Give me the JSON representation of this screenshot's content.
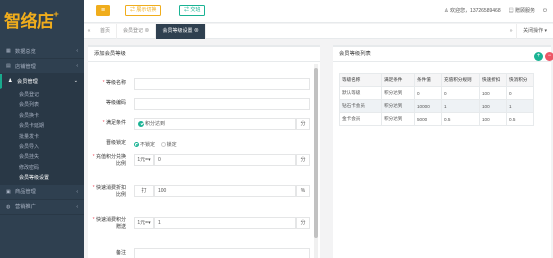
{
  "brand": {
    "logo_text": "智络店",
    "logo_plus": "+"
  },
  "sidebar": {
    "items": [
      {
        "label": "数据总览",
        "icon": "dashboard-icon"
      },
      {
        "label": "店铺管理",
        "icon": "store-icon"
      },
      {
        "label": "会员管理",
        "icon": "members-icon",
        "active": true
      },
      {
        "label": "商品管理",
        "icon": "goods-icon"
      },
      {
        "label": "营销推广",
        "icon": "marketing-icon"
      }
    ],
    "sub_items": [
      "会员登记",
      "会员列表",
      "会员换卡",
      "会员卡延期",
      "批量发卡",
      "会员导入",
      "会员挂失",
      "修改密码",
      "会员等级设置"
    ]
  },
  "topbar": {
    "orange_btn": "展示切换",
    "green_btn": "交班",
    "welcome": "欢迎您，13726589468",
    "service": "赠顾服务",
    "menu_icon": "menu-icon"
  },
  "tabs": {
    "home": "首页",
    "items": [
      "会员登记",
      "会员等级设置"
    ],
    "close_label": "×",
    "more_label": "关闭操作"
  },
  "form": {
    "title": "添加会员等级",
    "fields": {
      "level_name": {
        "label": "等级名称",
        "value": ""
      },
      "level_code": {
        "label": "等级编码",
        "value": ""
      },
      "condition": {
        "label": "满足条件",
        "value": "积分达到",
        "suffix": "分"
      },
      "upgrade_lock": {
        "label": "晋级锁定",
        "option_on": "不锁定",
        "option_off": "锁定"
      },
      "recharge_ratio": {
        "label": "充值积分兑换比例",
        "prefix": "1元=",
        "value": "0",
        "suffix": "分"
      },
      "discount": {
        "label": "快速消费折扣比例",
        "prefix": "打",
        "value": "100",
        "suffix": "%"
      },
      "points_ratio": {
        "label": "快速消费积分赠送",
        "prefix": "1元=",
        "value": "1",
        "suffix": "分"
      },
      "remark": {
        "label": "备注",
        "value": ""
      }
    }
  },
  "list": {
    "title": "会员等级列表",
    "add_label": "+",
    "delete_label": "−",
    "columns": [
      "等级名称",
      "满足条件",
      "条件值",
      "充值积分规则",
      "快速折扣",
      "快消积分"
    ],
    "rows": [
      [
        "默认等级",
        "积分达到",
        "0",
        "0",
        "100",
        "0"
      ],
      [
        "钻石卡会员",
        "积分达到",
        "10000",
        "1",
        "100",
        "1"
      ],
      [
        "金卡会员",
        "积分达到",
        "5000",
        "0.5",
        "100",
        "0.5"
      ]
    ]
  },
  "colors": {
    "accent": "#f0ad1c",
    "primary": "#1ab394",
    "danger": "#ed5565",
    "sidebar": "#2f4050"
  }
}
